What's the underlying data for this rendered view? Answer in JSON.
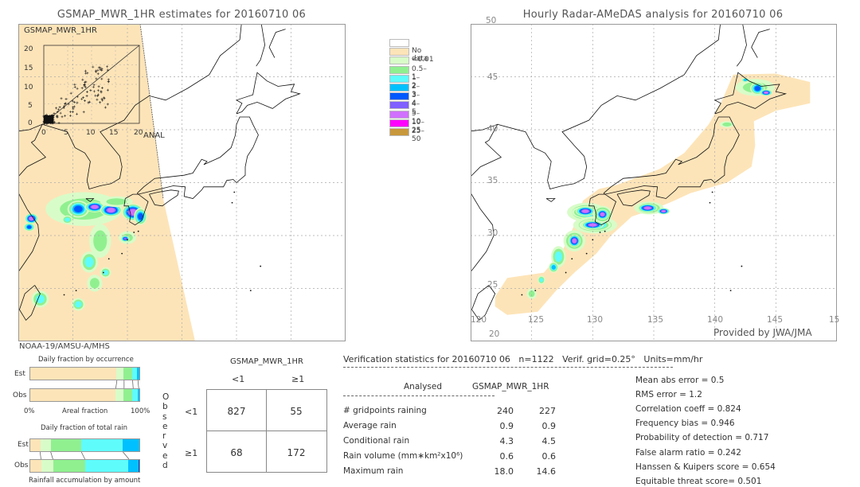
{
  "left_map": {
    "title": "GSMAP_MWR_1HR estimates for 20160710 06",
    "inset_label": "GSMAP_MWR_1HR",
    "inset_x_label": "ANAL",
    "inset_ticks": [
      "0",
      "5",
      "10",
      "15",
      "20"
    ],
    "sensor": "NOAA-19/AMSU-A/MHS"
  },
  "right_map": {
    "title": "Hourly Radar-AMeDAS analysis for 20160710 06",
    "lat_labels": [
      "45",
      "40",
      "35",
      "30",
      "25",
      "20"
    ],
    "lon_labels": [
      "120",
      "125",
      "130",
      "135",
      "140",
      "145",
      "15"
    ],
    "top_lat_label": "50",
    "credit": "Provided by JWA/JMA"
  },
  "legend": [
    {
      "label": "",
      "color": "#ffffff"
    },
    {
      "label": "No data",
      "color": "#fde4b8"
    },
    {
      "label": "<0.01",
      "color": "#d8fcc8"
    },
    {
      "label": "0.5–1",
      "color": "#90f090"
    },
    {
      "label": "1–2",
      "color": "#5ffcfc"
    },
    {
      "label": "2–3",
      "color": "#00c0ff"
    },
    {
      "label": "3–4",
      "color": "#0058ff"
    },
    {
      "label": "4–5",
      "color": "#8060ff"
    },
    {
      "label": "5–10",
      "color": "#d070ff"
    },
    {
      "label": "10–25",
      "color": "#ff00ff"
    },
    {
      "label": "25–50",
      "color": "#c8983c"
    }
  ],
  "occurrence": {
    "title": "Daily fraction by occurrence",
    "est_label": "Est",
    "obs_label": "Obs",
    "axis_left": "0%",
    "axis_mid": "Areal fraction",
    "axis_right": "100%",
    "est_fractions": [
      79,
      6.5,
      7.7,
      4.8,
      2
    ],
    "obs_fractions": [
      78,
      7.5,
      8.2,
      5,
      1.3
    ]
  },
  "total_rain": {
    "title": "Daily fraction of total rain",
    "est_label": "Est",
    "obs_label": "Obs",
    "caption": "Rainfall accumulation by amount",
    "est_fractions": [
      9.6,
      9.6,
      27.7,
      37.6,
      15.5
    ],
    "obs_fractions": [
      10.4,
      10.8,
      28.9,
      39.8,
      9.4,
      0.7
    ]
  },
  "segment_colors": [
    "#fde4b8",
    "#d8fcc8",
    "#90f090",
    "#5ffcfc",
    "#00c0ff",
    "#0040c0"
  ],
  "contingency": {
    "header": "GSMAP_MWR_1HR",
    "col_labels": [
      "<1",
      "≥1"
    ],
    "row_title": "Observed",
    "row_labels": [
      "<1",
      "≥1"
    ],
    "cells": [
      [
        "827",
        "55"
      ],
      [
        "68",
        "172"
      ]
    ]
  },
  "stats": {
    "header": "Verification statistics for 20160710 06   n=1122   Verif. grid=0.25°   Units=mm/hr",
    "col_analysed": "Analysed",
    "col_est": "GSMAP_MWR_1HR",
    "rows": [
      {
        "label": "# gridpoints raining",
        "analysed": "240",
        "est": "227"
      },
      {
        "label": "Average rain",
        "analysed": "0.9",
        "est": "0.9"
      },
      {
        "label": "Conditional rain",
        "analysed": "4.3",
        "est": "4.5"
      },
      {
        "label": "Rain volume (mm∗km²x10⁶)",
        "analysed": "0.6",
        "est": "0.6"
      },
      {
        "label": "Maximum rain",
        "analysed": "18.0",
        "est": "14.6"
      }
    ],
    "scores": [
      "Mean abs error = 0.5",
      "RMS error = 1.2",
      "Correlation coeff = 0.824",
      "Frequency bias = 0.946",
      "Probability of detection = 0.717",
      "False alarm ratio = 0.242",
      "Hanssen & Kuipers score = 0.654",
      "Equitable threat score= 0.501"
    ]
  }
}
